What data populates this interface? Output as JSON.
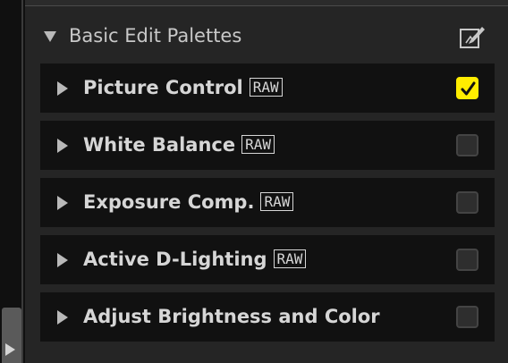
{
  "panel": {
    "title": "Basic Edit Palettes",
    "header_icon": "edit-palette-icon",
    "collapse_icon": "triangle-down-icon"
  },
  "palettes": [
    {
      "label": "Picture Control",
      "raw": "RAW",
      "checked": true
    },
    {
      "label": "White Balance",
      "raw": "RAW",
      "checked": false
    },
    {
      "label": "Exposure Comp.",
      "raw": "RAW",
      "checked": false
    },
    {
      "label": "Active D-Lighting",
      "raw": "RAW",
      "checked": false
    },
    {
      "label": "Adjust Brightness and Color",
      "raw": "",
      "checked": false
    }
  ],
  "colors": {
    "check_accent": "#ffed00",
    "row_bg": "#111111",
    "panel_bg": "#252525"
  }
}
